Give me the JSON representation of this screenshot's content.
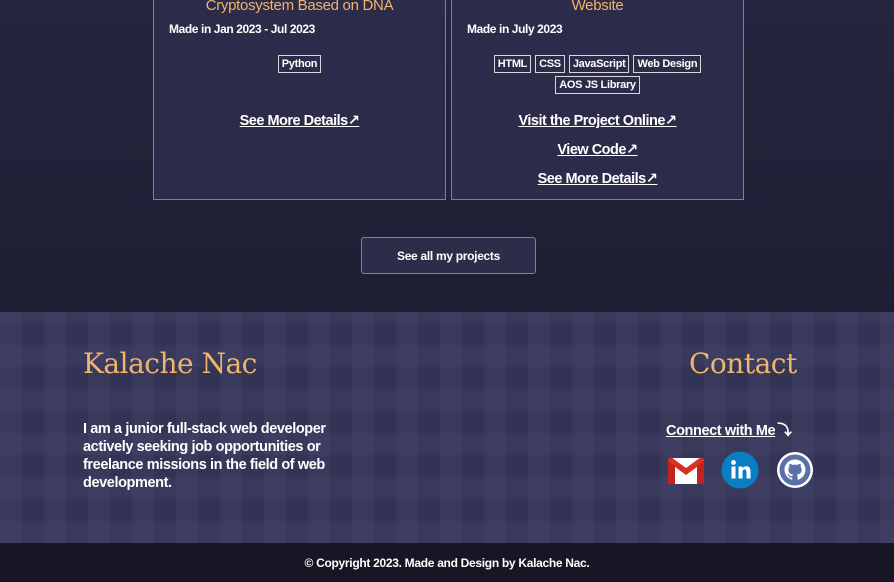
{
  "projects": [
    {
      "title": "Cryptosystem Based on DNA",
      "date": "Made in Jan 2023 - Jul 2023",
      "tags": [
        "Python"
      ],
      "links": {
        "details": "See More Details↗"
      }
    },
    {
      "title": "Website",
      "date": "Made in July 2023",
      "tags": [
        "HTML",
        "CSS",
        "JavaScript",
        "Web Design",
        "AOS JS Library"
      ],
      "links": {
        "online": "Visit the Project Online↗",
        "code": "View Code↗",
        "details": "See More Details↗"
      }
    }
  ],
  "see_all_label": "See all my projects",
  "footer": {
    "brand": "Kalache Nac",
    "bio": "I am a junior full-stack web developer actively seeking job opportunities or freelance missions in the field of web development.",
    "contact_heading": "Contact",
    "connect_label": "Connect with Me",
    "connect_arrow": "⤵",
    "socials": [
      "gmail-icon",
      "linkedin-icon",
      "github-icon"
    ]
  },
  "copyright": "© Copyright 2023. Made and Design by Kalache Nac.",
  "colors": {
    "accent": "#f0b46a",
    "border": "#9a7f5a",
    "background": "#1f1f35"
  }
}
